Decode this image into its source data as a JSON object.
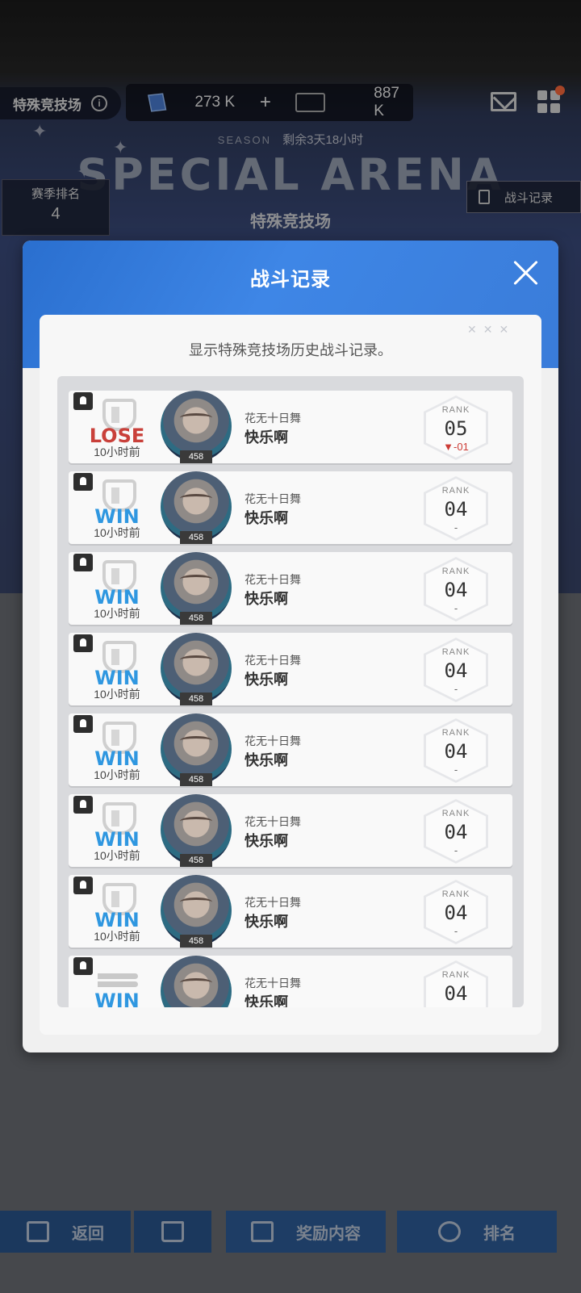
{
  "topbar": {
    "arena_label": "特殊竞技场",
    "currency1": "273 K",
    "currency1_plus": "+",
    "currency2": "887 K"
  },
  "season": {
    "tag": "SEASON",
    "remaining": "剩余3天18小时",
    "title": "SPECIAL ARENA",
    "subtitle": "特殊竞技场",
    "rank_label": "赛季排名",
    "rank_value": "4",
    "record_button": "战斗记录"
  },
  "modal": {
    "title": "战斗记录",
    "description": "显示特殊竞技场历史战斗记录。",
    "records": [
      {
        "result": "LOSE",
        "time": "10小时前",
        "guild": "花无十日舞",
        "name": "快乐啊",
        "level": "458",
        "rank_label": "RANK",
        "rank": "05",
        "change": "▼-01"
      },
      {
        "result": "WIN",
        "time": "10小时前",
        "guild": "花无十日舞",
        "name": "快乐啊",
        "level": "458",
        "rank_label": "RANK",
        "rank": "04",
        "change": "-"
      },
      {
        "result": "WIN",
        "time": "10小时前",
        "guild": "花无十日舞",
        "name": "快乐啊",
        "level": "458",
        "rank_label": "RANK",
        "rank": "04",
        "change": "-"
      },
      {
        "result": "WIN",
        "time": "10小时前",
        "guild": "花无十日舞",
        "name": "快乐啊",
        "level": "458",
        "rank_label": "RANK",
        "rank": "04",
        "change": "-"
      },
      {
        "result": "WIN",
        "time": "10小时前",
        "guild": "花无十日舞",
        "name": "快乐啊",
        "level": "458",
        "rank_label": "RANK",
        "rank": "04",
        "change": "-"
      },
      {
        "result": "WIN",
        "time": "10小时前",
        "guild": "花无十日舞",
        "name": "快乐啊",
        "level": "458",
        "rank_label": "RANK",
        "rank": "04",
        "change": "-"
      },
      {
        "result": "WIN",
        "time": "10小时前",
        "guild": "花无十日舞",
        "name": "快乐啊",
        "level": "458",
        "rank_label": "RANK",
        "rank": "04",
        "change": "-"
      },
      {
        "result": "WIN",
        "time": "",
        "guild": "花无十日舞",
        "name": "快乐啊",
        "level": "",
        "rank_label": "RANK",
        "rank": "04",
        "change": ""
      }
    ]
  },
  "bottom_nav": {
    "back": "返回",
    "rewards": "奖励内容",
    "ranking": "排名"
  },
  "colors": {
    "win": "#2f97e0",
    "lose": "#c9403a",
    "header_blue": "#3a7cd9"
  }
}
